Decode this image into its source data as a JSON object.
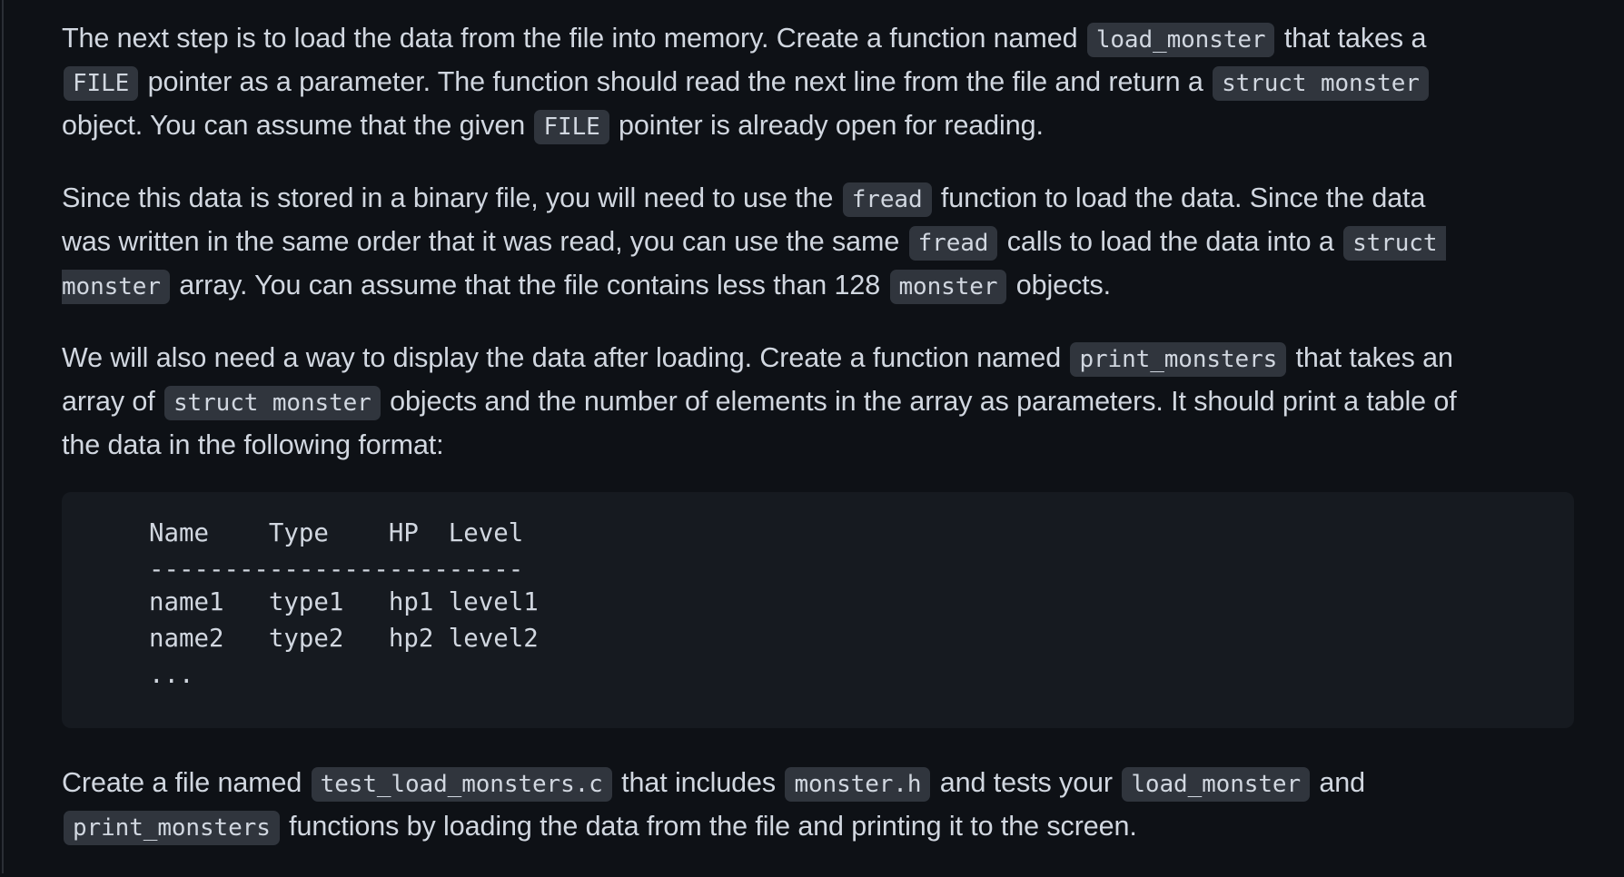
{
  "document": {
    "paragraphs": [
      {
        "id": "load-monster-intro",
        "lines": [
          [
            {
              "t": "The next step is to load the data from the file into memory. Create a function named "
            },
            {
              "code": "load_monster"
            },
            {
              "t": " that takes a"
            }
          ],
          [
            {
              "code": "FILE"
            },
            {
              "t": " pointer as a parameter. The function should read the next line from the file and return a "
            },
            {
              "code": "struct monster"
            }
          ],
          [
            {
              "t": "object. You can assume that the given "
            },
            {
              "code": "FILE"
            },
            {
              "t": " pointer is already open for reading."
            }
          ]
        ]
      },
      {
        "id": "fread-explanation",
        "lines": [
          [
            {
              "t": "Since this data is stored in a binary file, you will need to use the "
            },
            {
              "code": "fread"
            },
            {
              "t": " function to load the data. Since the data"
            }
          ],
          [
            {
              "t": "was written in the same order that it was read, you can use the same "
            },
            {
              "code": "fread"
            },
            {
              "t": " calls to load the data into a "
            },
            {
              "code": "struct ",
              "cont": "right"
            }
          ],
          [
            {
              "code": "monster",
              "cont": "left"
            },
            {
              "t": " array. You can assume that the file contains less than 128 "
            },
            {
              "code": "monster"
            },
            {
              "t": " objects."
            }
          ]
        ]
      },
      {
        "id": "print-monsters-intro",
        "lines": [
          [
            {
              "t": "We will also need a way to display the data after loading. Create a function named "
            },
            {
              "code": "print_monsters"
            },
            {
              "t": " that takes an"
            }
          ],
          [
            {
              "t": "array of "
            },
            {
              "code": "struct monster"
            },
            {
              "t": " objects and the number of elements in the array as parameters. It should print a table of"
            }
          ],
          [
            {
              "t": "the data in the following format:"
            }
          ]
        ]
      }
    ],
    "code_block": {
      "lines": [
        "Name    Type    HP  Level",
        "-------------------------",
        "name1   type1   hp1 level1",
        "name2   type2   hp2 level2",
        "..."
      ]
    },
    "final_paragraph": {
      "id": "test-file-instructions",
      "lines": [
        [
          {
            "t": "Create a file named "
          },
          {
            "code": "test_load_monsters.c"
          },
          {
            "t": " that includes "
          },
          {
            "code": "monster.h"
          },
          {
            "t": " and tests your "
          },
          {
            "code": "load_monster"
          },
          {
            "t": " and"
          }
        ],
        [
          {
            "code": "print_monsters"
          },
          {
            "t": " functions by loading the data from the file and printing it to the screen."
          }
        ]
      ]
    }
  },
  "colors": {
    "background": "#0e1116",
    "text": "#d1d7e0",
    "inline_code_bg": "#30353d",
    "code_block_bg": "#161a20"
  }
}
